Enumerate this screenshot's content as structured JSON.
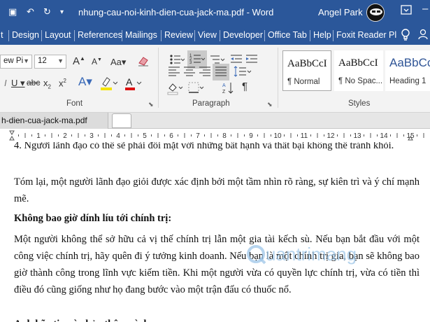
{
  "titlebar": {
    "doc_title": "nhung-cau-noi-kinh-dien-cua-jack-ma.pdf  -  Word",
    "user_name": "Angel Park"
  },
  "tabs": [
    "t",
    "Design",
    "Layout",
    "References",
    "Mailings",
    "Review",
    "View",
    "Developer",
    "Office Tab",
    "Help",
    "Foxit Reader Pl"
  ],
  "ribbon": {
    "font_name": "ew Pi",
    "font_size": "12",
    "groups": {
      "font": "Font",
      "paragraph": "Paragraph",
      "styles": "Styles"
    },
    "styles": [
      {
        "sample": "AaBbCcI",
        "name": "¶ Normal"
      },
      {
        "sample": "AaBbCcI",
        "name": "¶ No Spac..."
      },
      {
        "sample": "AaBbCc",
        "name": "Heading 1"
      }
    ]
  },
  "doc_tab": {
    "label": "h-dien-cua-jack-ma.pdf"
  },
  "ruler": {
    "labels": [
      "1",
      "2",
      "3",
      "4",
      "5",
      "6",
      "7",
      "8",
      "9",
      "10",
      "11",
      "12",
      "13",
      "14",
      "15"
    ]
  },
  "document": {
    "paragraphs": [
      {
        "text": "4.       Người lãnh đạo có thể sẽ phải đối mặt với những bất hạnh và thất bại không thể tránh khỏi."
      },
      {
        "text": "Tóm lại, một người lãnh đạo giỏi được xác định bởi một tầm nhìn rõ ràng, sự kiên trì và ý chí mạnh mẽ."
      },
      {
        "text": "Không bao giờ dính líu tới chính trị:"
      },
      {
        "text": "Một người không thể sở hữu cả vị thế chính trị lẫn một gia tài kếch sù. Nếu bạn bắt đầu với một công việc chính trị, hãy quên đi ý tưởng kinh doanh. Nếu bạn là một chính trị gia, bạn sẽ không bao giờ thành công trong lĩnh vực kiếm tiền. Khi một người vừa có quyền lực chính trị, vừa có tiền thì điều đó cũng giống như họ đang bước vào một trận đấu có thuốc nổ."
      },
      {
        "text": "Anh hãy tin vào bản thân mình:"
      }
    ]
  },
  "watermark": {
    "text": "uantrimang"
  },
  "colors": {
    "word_blue": "#2b579a",
    "ribbon_bg": "#f3f3f3",
    "highlight_yellow": "#f5e400",
    "font_red": "#d11"
  }
}
